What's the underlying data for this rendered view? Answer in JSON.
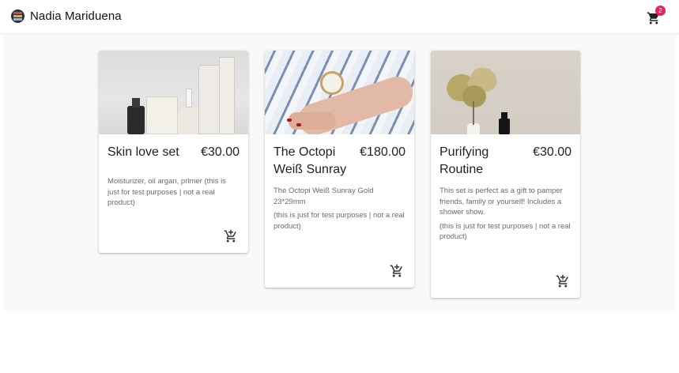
{
  "header": {
    "brand_name": "Nadia Mariduena",
    "cart_count": "2",
    "cart_icon": "shopping-cart-icon"
  },
  "colors": {
    "badge": "#e91e63",
    "background": "#f9f9f9",
    "text": "#222222",
    "muted_text": "#6b6b6b"
  },
  "products": [
    {
      "title": "Skin love set",
      "price": "€30.00",
      "description": [
        "Moisturizer, oil argan, primer (this is just for test purposes | not a real product)"
      ],
      "add_icon": "add-to-cart-icon"
    },
    {
      "title": "The Octopi Weiß Sunray",
      "price": "€180.00",
      "description": [
        "The Octopi Weiß Sunray Gold 23*29mm",
        "(this is just for test purposes | not a real product)"
      ],
      "add_icon": "add-to-cart-icon"
    },
    {
      "title": "Purifying Routine",
      "price": "€30.00",
      "description": [
        "This set is perfect as a gift to pamper friends, family or yourself! Includes a shower show.",
        "(this is just for test purposes | not a real product)"
      ],
      "add_icon": "add-to-cart-icon"
    }
  ]
}
